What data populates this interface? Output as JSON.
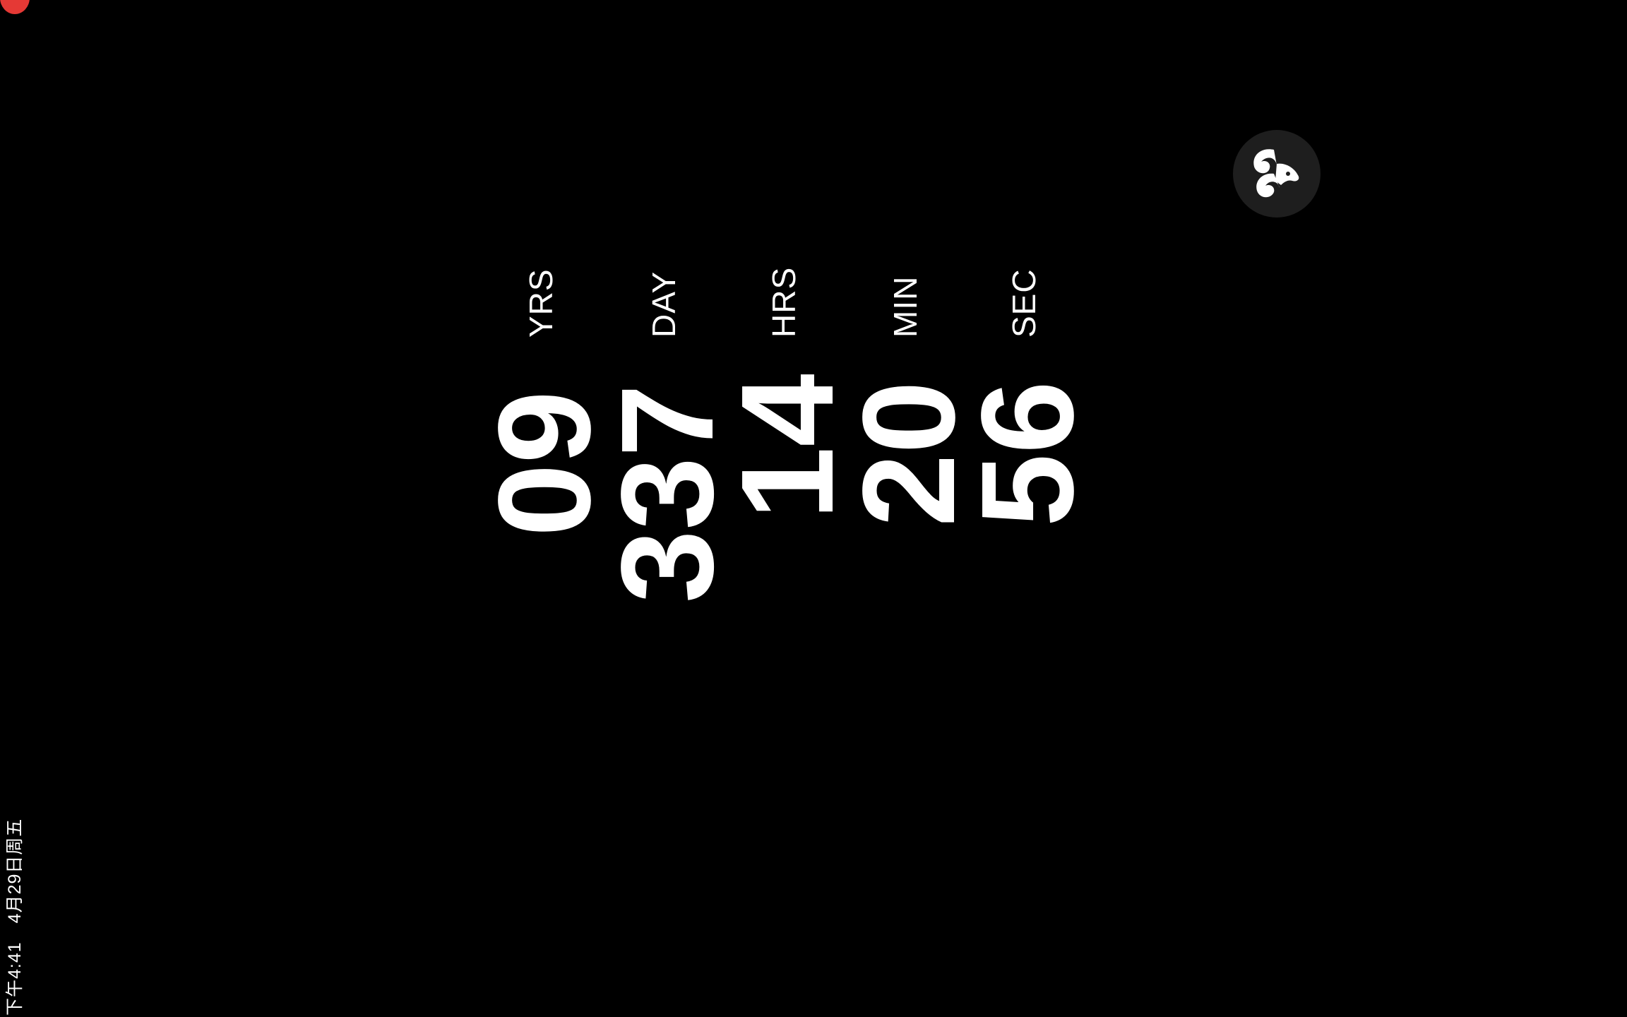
{
  "status_bar": {
    "time": "下午4:41",
    "date": "4月29日周五"
  },
  "recording_indicator_color": "#e53935",
  "logo": {
    "icon": "aries-ram-icon",
    "badge_color": "#1e1e1e"
  },
  "countdown": {
    "units": [
      {
        "label": "YRS",
        "value": "09"
      },
      {
        "label": "DAY",
        "value": "337"
      },
      {
        "label": "HRS",
        "value": "14"
      },
      {
        "label": "MIN",
        "value": "20"
      },
      {
        "label": "SEC",
        "value": "56"
      }
    ]
  }
}
